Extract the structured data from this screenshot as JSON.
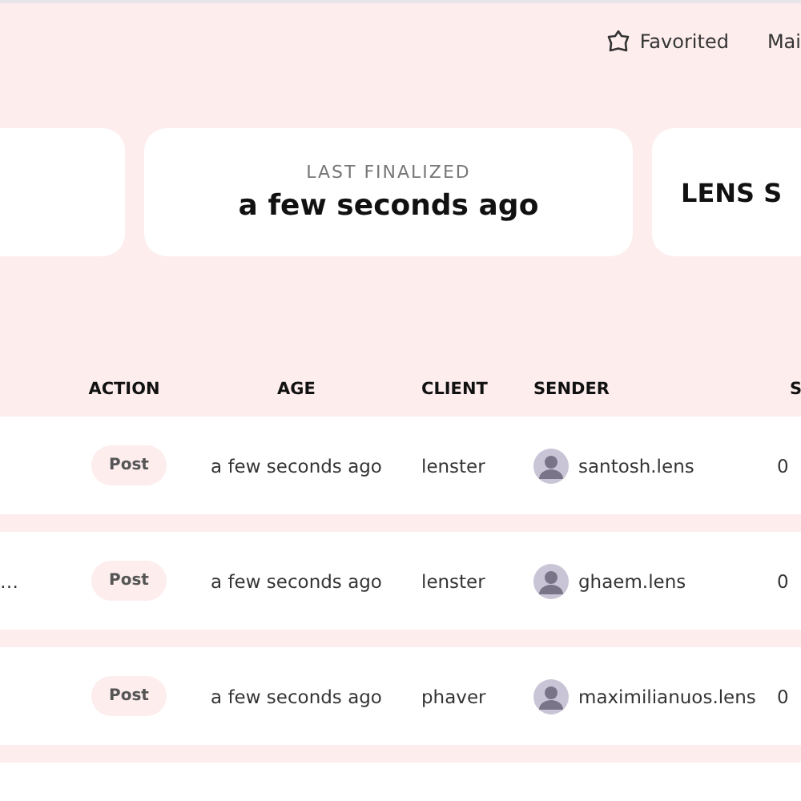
{
  "nav": {
    "links": [
      {
        "label": "Favorited"
      },
      {
        "label": "Mai"
      }
    ]
  },
  "stats": [
    {
      "kind": "blank"
    },
    {
      "kind": "stat",
      "label": "LAST FINALIZED",
      "value": "a few seconds ago"
    },
    {
      "kind": "stat",
      "value": "LENS S"
    }
  ],
  "table": {
    "columns": [
      "ACTION",
      "AGE",
      "CLIENT",
      "SENDER",
      "S"
    ],
    "rows": [
      {
        "column_1": "",
        "action": "Post",
        "age": "a few seconds ago",
        "client": "lenster",
        "sender": "santosh.lens",
        "column_6": "0"
      },
      {
        "column_1": "…",
        "action": "Post",
        "age": "a few seconds ago",
        "client": "lenster",
        "sender": "ghaem.lens",
        "column_6": "0"
      },
      {
        "column_1": "",
        "action": "Post",
        "age": "a few seconds ago",
        "client": "phaver",
        "sender": "maximilianuos.lens",
        "column_6": "0"
      }
    ]
  }
}
